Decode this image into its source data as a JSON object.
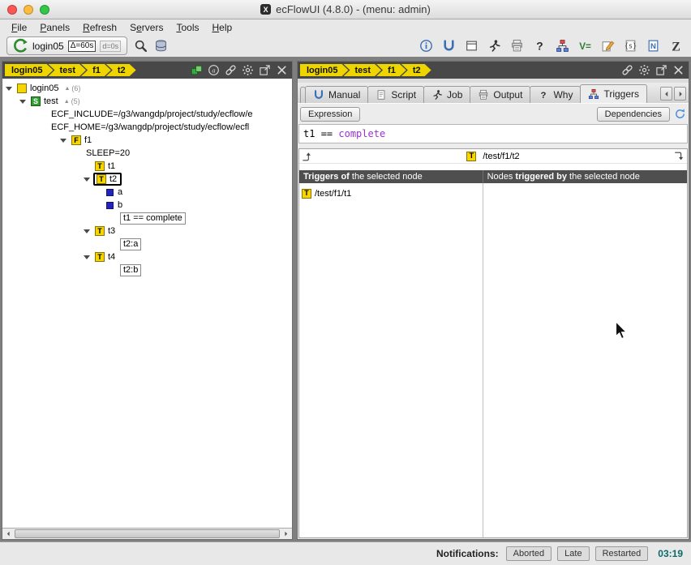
{
  "window": {
    "title": "ecFlowUI (4.8.0) - (menu: admin)",
    "x11_badge": "X"
  },
  "menu_bar": {
    "items": [
      {
        "label": "File",
        "accel": 0
      },
      {
        "label": "Panels",
        "accel": 0
      },
      {
        "label": "Refresh",
        "accel": 0
      },
      {
        "label": "Servers",
        "accel": 1
      },
      {
        "label": "Tools",
        "accel": 0
      },
      {
        "label": "Help",
        "accel": 0
      }
    ]
  },
  "toolbar": {
    "server_button": {
      "label": "login05",
      "badge_primary": "Δ=60s",
      "badge_secondary": "d=0s"
    },
    "left_icons": [
      "search-icon",
      "servers-icon"
    ],
    "right_icons": [
      "info-icon",
      "manual-icon",
      "panel-icon",
      "job-icon",
      "output-icon",
      "why-icon",
      "triggers-icon",
      "variable-icon",
      "edit-icon",
      "shell-icon",
      "notes-icon",
      "logo-z-icon"
    ]
  },
  "left_panel": {
    "breadcrumb": {
      "items": [
        "login05",
        "test",
        "f1",
        "t2"
      ],
      "icons": [
        "layers-icon",
        "attributes-icon",
        "link-icon",
        "gear-icon",
        "detach-icon",
        "close-icon"
      ]
    },
    "tree": [
      {
        "kind": "node",
        "depth": 0,
        "expander": true,
        "icon": "server",
        "icon_letter": "",
        "label": "login05",
        "suffix": "(6)"
      },
      {
        "kind": "node",
        "depth": 1,
        "expander": true,
        "icon": "suite",
        "icon_letter": "S",
        "label": "test",
        "suffix": "(5)"
      },
      {
        "kind": "attr",
        "depth": 2,
        "label": "ECF_INCLUDE=/g3/wangdp/project/study/ecflow/e"
      },
      {
        "kind": "attr",
        "depth": 2,
        "label": "ECF_HOME=/g3/wangdp/project/study/ecflow/ecfl"
      },
      {
        "kind": "node",
        "depth": 2,
        "expander": true,
        "icon": "family",
        "icon_letter": "F",
        "label": "f1"
      },
      {
        "kind": "attr",
        "depth": 3,
        "label": "SLEEP=20"
      },
      {
        "kind": "node",
        "depth": 3,
        "expander": false,
        "icon": "task",
        "icon_letter": "T",
        "label": "t1"
      },
      {
        "kind": "node",
        "depth": 3,
        "expander": true,
        "icon": "task",
        "icon_letter": "T",
        "label": "t2",
        "selected": true
      },
      {
        "kind": "event",
        "depth": 4,
        "label": "a"
      },
      {
        "kind": "event",
        "depth": 4,
        "label": "b"
      },
      {
        "kind": "boxed",
        "depth": 4,
        "label": "t1 == complete"
      },
      {
        "kind": "node",
        "depth": 3,
        "expander": true,
        "icon": "task",
        "icon_letter": "T",
        "label": "t3"
      },
      {
        "kind": "boxed",
        "depth": 4,
        "label": "t2:a"
      },
      {
        "kind": "node",
        "depth": 3,
        "expander": true,
        "icon": "task",
        "icon_letter": "T",
        "label": "t4"
      },
      {
        "kind": "boxed",
        "depth": 4,
        "label": "t2:b"
      }
    ]
  },
  "right_panel": {
    "breadcrumb": {
      "items": [
        "login05",
        "test",
        "f1",
        "t2"
      ],
      "icons": [
        "link-icon",
        "gear-icon",
        "detach-icon",
        "close-icon"
      ]
    },
    "tabs": [
      {
        "label": "Manual",
        "icon": "manual-icon",
        "selected": false
      },
      {
        "label": "Script",
        "icon": "script-icon",
        "selected": false
      },
      {
        "label": "Job",
        "icon": "job-icon",
        "selected": false
      },
      {
        "label": "Output",
        "icon": "output-icon",
        "selected": false
      },
      {
        "label": "Why",
        "icon": "why-icon",
        "selected": false
      },
      {
        "label": "Triggers",
        "icon": "triggers-icon",
        "selected": true
      }
    ],
    "triggers_view": {
      "expression_button": "Expression",
      "dependencies_button": "Dependencies",
      "expression_tokens": [
        {
          "text": "t1 ",
          "color": "#000000"
        },
        {
          "text": "== ",
          "color": "#000000"
        },
        {
          "text": "complete",
          "color": "#9b30d0"
        }
      ],
      "path_bar": {
        "node_letter": "T",
        "path": "/test/f1/t2"
      },
      "columns": {
        "left": {
          "header": {
            "pre": "",
            "bold": "Triggers of",
            "rest": " the selected node"
          },
          "items": [
            {
              "icon_letter": "T",
              "path": "/test/f1/t1"
            }
          ]
        },
        "right": {
          "header": {
            "pre": "Nodes ",
            "bold": "triggered by",
            "rest": " the selected node"
          },
          "items": []
        }
      }
    }
  },
  "status_bar": {
    "label": "Notifications:",
    "buttons": [
      "Aborted",
      "Late",
      "Restarted"
    ],
    "time": "03:19"
  },
  "colors": {
    "node_yellow": "#f7d500",
    "suite_green": "#2fa12f",
    "event_blue": "#2323bb",
    "crumb_yellow": "#eed500",
    "header_dark": "#4f4f4f",
    "expression_purple": "#9b30d0",
    "time_teal": "#0a6a6a"
  }
}
